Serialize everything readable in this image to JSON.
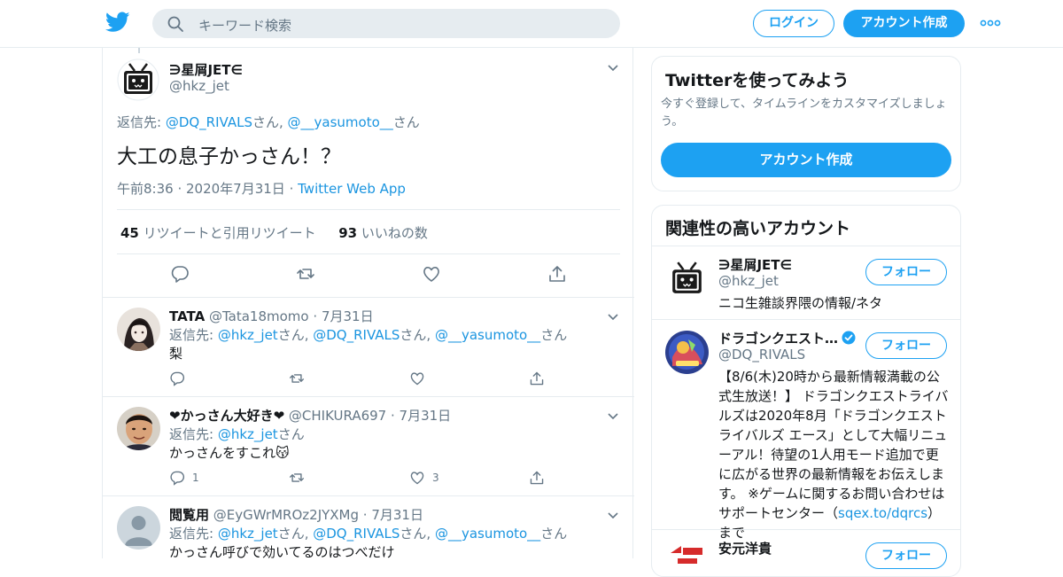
{
  "header": {
    "search_placeholder": "キーワード検索",
    "login_label": "ログイン",
    "signup_label": "アカウント作成"
  },
  "tweet": {
    "name": "∋星屑JET∈",
    "handle": "@hkz_jet",
    "reply_prefix": "返信先: ",
    "reply_to": [
      {
        "handle": "@DQ_RIVALS",
        "suffix": "さん, "
      },
      {
        "handle": "@__yasumoto__",
        "suffix": "さん"
      }
    ],
    "text": "大工の息子かっさん！？",
    "time": "午前8:36",
    "date": "2020年7月31日",
    "source": "Twitter Web App",
    "retweets_count": "45",
    "retweets_label": "リツイートと引用リツイート",
    "likes_count": "93",
    "likes_label": "いいねの数"
  },
  "replies": [
    {
      "name": "TATA",
      "handle": "@Tata18momo",
      "date": "7月31日",
      "reply_prefix": "返信先: ",
      "reply_to": [
        {
          "handle": "@hkz_jet",
          "suffix": "さん, "
        },
        {
          "handle": "@DQ_RIVALS",
          "suffix": "さん, "
        },
        {
          "handle": "@__yasumoto__",
          "suffix": "さん"
        }
      ],
      "text": "梨",
      "reply_count": "",
      "like_count": ""
    },
    {
      "name": "❤かっさん大好き❤",
      "handle": "@CHIKURA697",
      "date": "7月31日",
      "reply_prefix": "返信先: ",
      "reply_to": [
        {
          "handle": "@hkz_jet",
          "suffix": "さん"
        }
      ],
      "text": "かっさんをすこれ😽",
      "reply_count": "1",
      "like_count": "3"
    },
    {
      "name": "閲覧用",
      "handle": "@EyGWrMROz2JYXMg",
      "date": "7月31日",
      "reply_prefix": "返信先: ",
      "reply_to": [
        {
          "handle": "@hkz_jet",
          "suffix": "さん, "
        },
        {
          "handle": "@DQ_RIVALS",
          "suffix": "さん, "
        },
        {
          "handle": "@__yasumoto__",
          "suffix": "さん"
        }
      ],
      "text": "かっさん呼びで効いてるのはつべだけ",
      "reply_count": "",
      "like_count": ""
    }
  ],
  "sidebar": {
    "signup_card": {
      "title": "Twitterを使ってみよう",
      "subtitle": "今すぐ登録して、タイムラインをカスタマイズしましょう。",
      "button": "アカウント作成"
    },
    "related": {
      "title": "関連性の高いアカウント",
      "follow_label": "フォロー",
      "accounts": [
        {
          "name": "∋星屑JET∈",
          "handle": "@hkz_jet",
          "bio": "ニコ生雑談界隈の情報/ネタ",
          "verified": false
        },
        {
          "name": "ドラゴンクエスト…",
          "handle": "@DQ_RIVALS",
          "bio": "【8/6(木)20時から最新情報満載の公式生放送！】 ドラゴンクエストライバルズは2020年8月「ドラゴンクエストライバルズ エース」として大幅リニューアル！待望の1人用モード追加で更に広がる世界の最新情報をお伝えします。 ※ゲームに関するお問い合わせはサポートセンター（",
          "bio_link": "sqex.to/dqrcs",
          "bio_tail": "）まで",
          "verified": true
        },
        {
          "name": "安元洋貴",
          "handle": "",
          "bio": "",
          "verified": false
        }
      ]
    }
  },
  "colors": {
    "accent": "#1da1f2",
    "link": "#1b95e0",
    "secondary_text": "#657786",
    "border": "#e6ecf0"
  }
}
